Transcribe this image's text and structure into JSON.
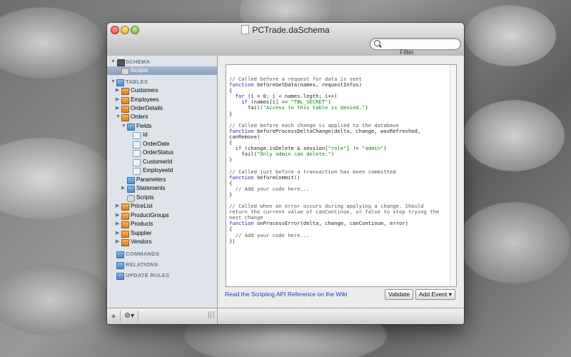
{
  "window": {
    "title": "PCTrade.daSchema"
  },
  "toolbar": {
    "filter_label": "Filter",
    "search_placeholder": ""
  },
  "sidebar": {
    "schema_section": "SCHEMA",
    "schema_scripts": "Scripts",
    "tables_section": "TABLES",
    "tables": [
      "Customers",
      "Employees",
      "OrderDetails",
      "Orders"
    ],
    "orders_children": {
      "fields_label": "Fields",
      "fields": [
        "Id",
        "OrderDate",
        "OrderStatus",
        "CustomerId",
        "EmployeeId"
      ],
      "parameters": "Parameters",
      "statements": "Statements",
      "scripts": "Scripts"
    },
    "more_tables": [
      "PriceList",
      "ProductGroups",
      "Products",
      "Supplier",
      "Vendors"
    ],
    "commands_section": "COMMANDS",
    "relations_section": "RELATIONS",
    "update_rules_section": "UPDATE RULES",
    "add_button": "+",
    "gear_button": "⚙▾"
  },
  "editor": {
    "lines": [
      {
        "t": "c",
        "v": "// Called before a request for data is sent"
      },
      {
        "t": "code",
        "v": "<k>function</k> beforeGetData(names, requestInfos)"
      },
      {
        "t": "code",
        "v": "{"
      },
      {
        "t": "code",
        "v": "  <k>for</k> (i = 0; i < names.legth; i++)"
      },
      {
        "t": "code",
        "v": "    <k>if</k> (names[i] == <s>\"TBL_SECRET\"</s>)"
      },
      {
        "t": "code",
        "v": "      fail(<s>\"Access to this table is denied.\"</s>)"
      },
      {
        "t": "code",
        "v": "}"
      },
      {
        "t": "code",
        "v": ""
      },
      {
        "t": "c",
        "v": "// Called before each change is applied to the database"
      },
      {
        "t": "code",
        "v": "<k>function</k> beforeProcessDeltaChange(delta, change, wasRefreshed,"
      },
      {
        "t": "code",
        "v": "canRemove)"
      },
      {
        "t": "code",
        "v": "{"
      },
      {
        "t": "code",
        "v": "  <k>if</k> (change.isDelete & session[<s>\"role\"</s>] != <s>\"admin\"</s>)"
      },
      {
        "t": "code",
        "v": "    fail(<s>\"Only admin can delete.\"</s>)"
      },
      {
        "t": "code",
        "v": "}"
      },
      {
        "t": "code",
        "v": ""
      },
      {
        "t": "c",
        "v": "// Called just before a transaction has been committed"
      },
      {
        "t": "code",
        "v": "<k>function</k> beforeCommit()"
      },
      {
        "t": "code",
        "v": "{"
      },
      {
        "t": "c",
        "v": "  // Add your code here..."
      },
      {
        "t": "code",
        "v": "}"
      },
      {
        "t": "code",
        "v": ""
      },
      {
        "t": "c",
        "v": "// Called when an error occurs during applying a change. Should"
      },
      {
        "t": "c",
        "v": "return the current value of canContinue, or false to stop trying the"
      },
      {
        "t": "c",
        "v": "next change"
      },
      {
        "t": "code",
        "v": "<k>function</k> onProcessError(delta, change, canContinue, error)"
      },
      {
        "t": "code",
        "v": "{"
      },
      {
        "t": "c",
        "v": "  // Add your code here..."
      },
      {
        "t": "code",
        "v": "}|"
      }
    ],
    "wiki_link": "Read the Scripting API Reference on the Wiki",
    "validate_button": "Validate",
    "add_event_button": "Add Event ▾"
  }
}
